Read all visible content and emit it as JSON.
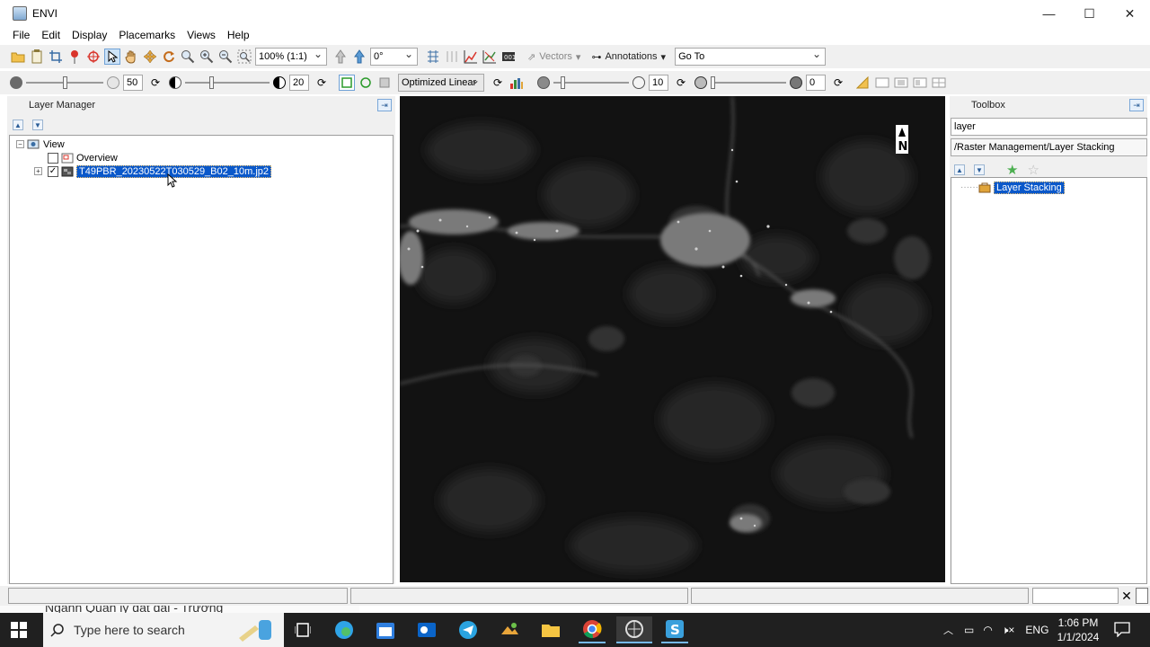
{
  "window": {
    "title": "ENVI",
    "minimize": "—",
    "maximize": "☐",
    "close": "✕"
  },
  "menu": [
    "File",
    "Edit",
    "Display",
    "Placemarks",
    "Views",
    "Help"
  ],
  "toolbar": {
    "zoom_value": "100% (1:1)",
    "rotation_value": "0°",
    "vectors_label": "Vectors",
    "annotations_label": "Annotations",
    "goto_value": "Go To",
    "brightness_value": "50",
    "contrast_value": "20",
    "stretch_value": "Optimized Linear",
    "sharpen_value": "10",
    "transparency_value": "0",
    "brightness_level": 0.5,
    "contrast_level": 0.3,
    "sharpen_level": 0.1,
    "transparency_level": 0.0
  },
  "layer_manager": {
    "title": "Layer Manager",
    "view_label": "View",
    "overview_label": "Overview",
    "layer_label": "T49PBR_20230522T030529_B02_10m.jp2",
    "layer_checked": "✓",
    "layer_visible": true
  },
  "toolbox": {
    "title": "Toolbox",
    "search_value": "layer",
    "path_value": "/Raster Management/Layer Stacking",
    "result_label": "Layer Stacking"
  },
  "image_view": {
    "north_arrow_label": "N"
  },
  "status": {
    "close_glyph": "✕"
  },
  "taskbar": {
    "search_placeholder": "Type here to search",
    "notification_text": "Ngành Quản lý đất đai - Trường",
    "language": "ENG",
    "time": "1:06 PM",
    "date": "1/1/2024"
  },
  "colors": {
    "selection": "#0a58ca",
    "taskbar": "#202020",
    "panel": "#f0f0f0"
  }
}
